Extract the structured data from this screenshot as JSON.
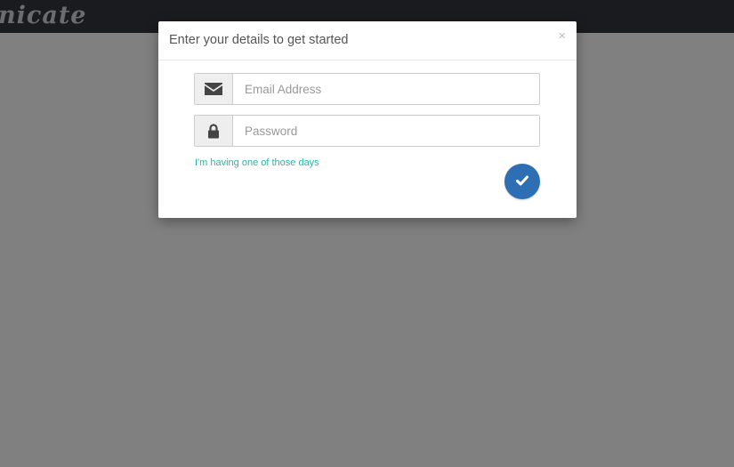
{
  "navbar": {
    "brand_text": "nicate"
  },
  "modal": {
    "title": "Enter your details to get started",
    "close_glyph": "×",
    "email": {
      "icon": "envelope-icon",
      "placeholder": "Email Address",
      "value": ""
    },
    "password": {
      "icon": "lock-icon",
      "placeholder": "Password",
      "value": ""
    },
    "forgot_link": "I'm having one of those days",
    "submit_icon": "check-icon"
  },
  "colors": {
    "navbar": "#1a1b1f",
    "backdrop": "#808080",
    "link": "#2ab4a4",
    "submit": "#2d6fb2"
  }
}
